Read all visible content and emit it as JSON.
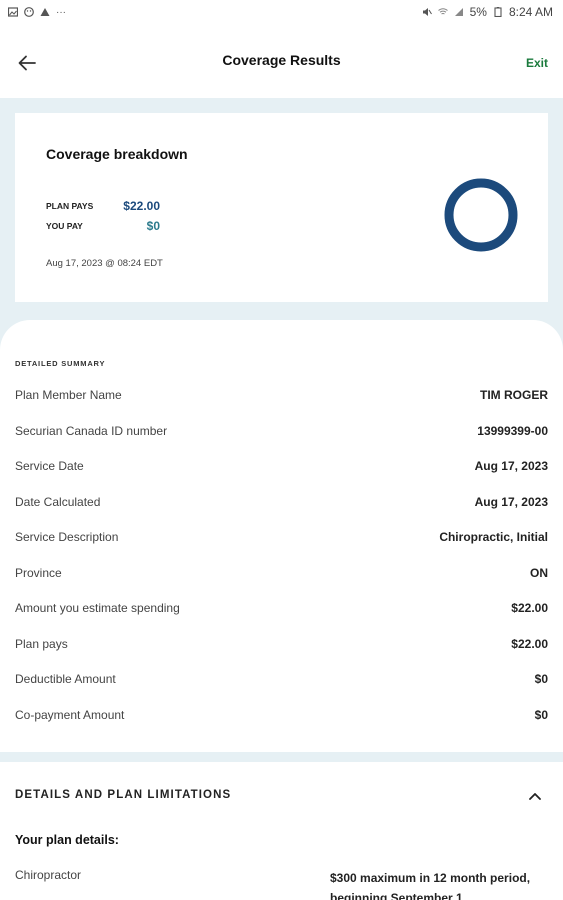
{
  "status_bar": {
    "battery": "5%",
    "time": "8:24 AM"
  },
  "header": {
    "title": "Coverage Results",
    "exit_label": "Exit"
  },
  "breakdown": {
    "title": "Coverage breakdown",
    "plan_pays_label": "PLAN PAYS",
    "plan_pays_value": "$22.00",
    "you_pay_label": "YOU PAY",
    "you_pay_value": "$0",
    "timestamp": "Aug 17, 2023 @ 08:24 EDT",
    "plan_pays_fraction": 1.0,
    "ring_color": "#1c4a7c"
  },
  "summary": {
    "caption": "DETAILED SUMMARY",
    "rows": [
      {
        "label": "Plan Member Name",
        "value": "TIM ROGER"
      },
      {
        "label": "Securian Canada ID number",
        "value": "13999399-00"
      },
      {
        "label": "Service Date",
        "value": "Aug 17, 2023"
      },
      {
        "label": "Date Calculated",
        "value": "Aug 17, 2023"
      },
      {
        "label": "Service Description",
        "value": "Chiropractic, Initial"
      },
      {
        "label": "Province",
        "value": "ON"
      },
      {
        "label": "Amount you estimate spending",
        "value": "$22.00"
      },
      {
        "label": "Plan pays",
        "value": "$22.00"
      },
      {
        "label": "Deductible Amount",
        "value": "$0"
      },
      {
        "label": "Co-payment Amount",
        "value": "$0"
      }
    ]
  },
  "details": {
    "header": "DETAILS AND PLAN LIMITATIONS",
    "plan_details_title": "Your plan details:",
    "item_label": "Chiropractor",
    "item_value": "$300 maximum in 12 month period, beginning September 1"
  },
  "colors": {
    "accent_green": "#1a7a3c",
    "accent_blue": "#1c4a7c",
    "page_background": "#e6f0f4"
  }
}
